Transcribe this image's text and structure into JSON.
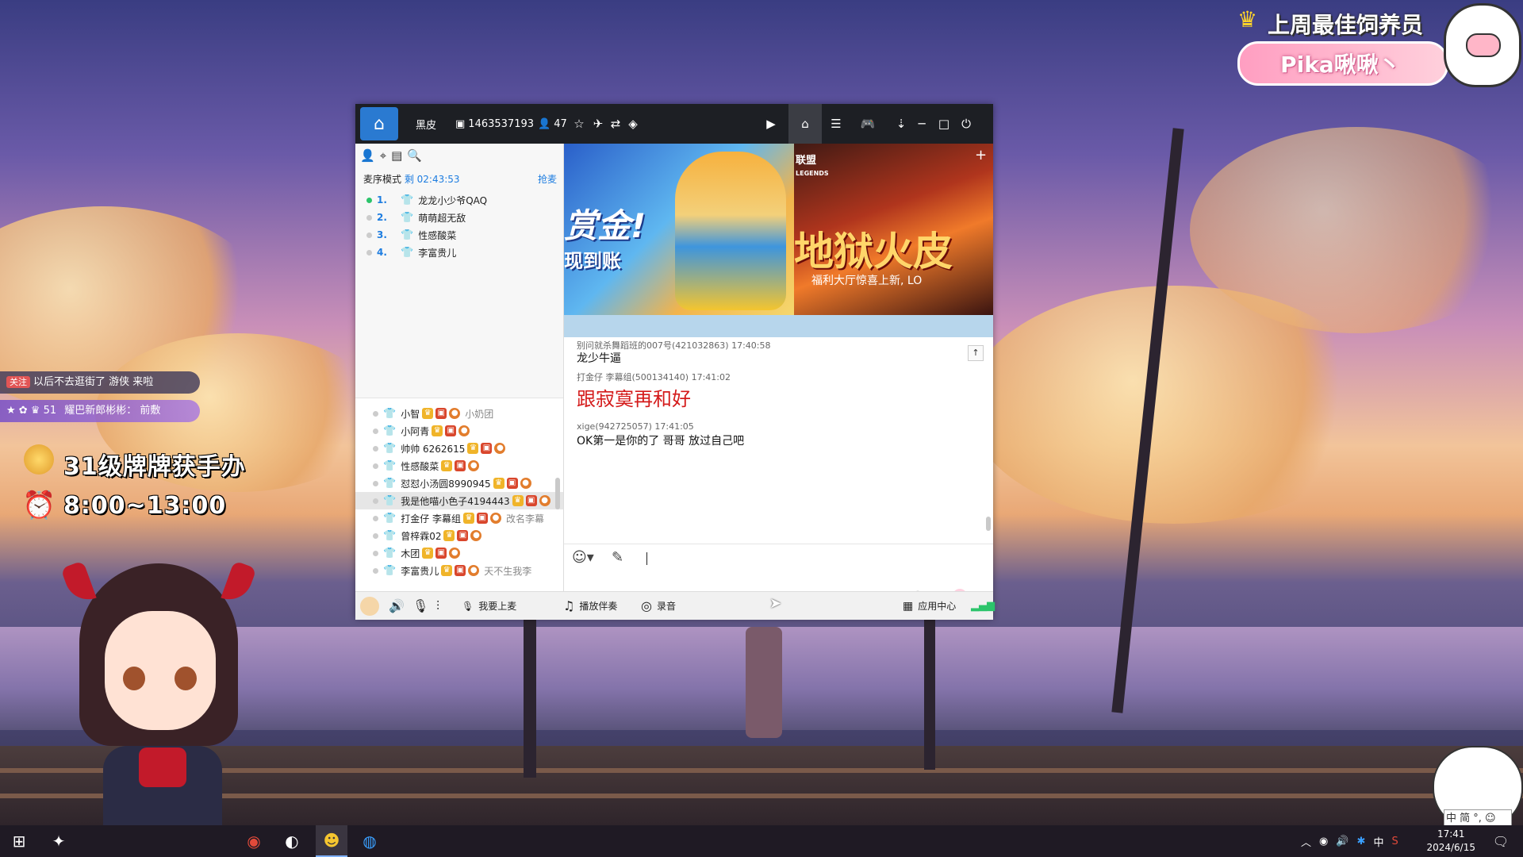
{
  "overlay": {
    "best_feeder_title": "上周最佳饲养员",
    "best_feeder_name": "Pika啾啾丶",
    "ticker1_tag": "关注",
    "ticker1_text": "以后不去逛街了 游侠 来啦",
    "ticker2_level": "51",
    "ticker2_text": "耀巴新郎彬彬： 前敷",
    "level_text": "31级牌牌获手办",
    "schedule_text": "8:00~13:00",
    "ime_text": "中 简 °, ☺"
  },
  "window": {
    "channel_name": "黑皮",
    "room_id": "1463537193",
    "online_count": "47",
    "left": {
      "mic_mode_label": "麦序模式",
      "mic_mode_time": "剩 02:43:53",
      "grab_mic": "抢麦",
      "queue": [
        {
          "num": "1.",
          "name": "龙龙小少爷QAQ",
          "active": true
        },
        {
          "num": "2.",
          "name": "萌萌超无敌",
          "active": false
        },
        {
          "num": "3.",
          "name": "性感酸菜",
          "active": false
        },
        {
          "num": "4.",
          "name": "李富贵儿",
          "active": false
        }
      ],
      "members": [
        {
          "name": "小智",
          "extra": "小奶团"
        },
        {
          "name": "小阿青",
          "extra": ""
        },
        {
          "name": "帅帅 6262615",
          "extra": ""
        },
        {
          "name": "性感酸菜",
          "extra": ""
        },
        {
          "name": "怼怼小汤圆8990945",
          "extra": ""
        },
        {
          "name": "我是他喵小色子4194443",
          "extra": ""
        },
        {
          "name": "打金仔 李幕组",
          "extra": "改名李幕"
        },
        {
          "name": "曾梓霖02",
          "extra": ""
        },
        {
          "name": "木团",
          "extra": ""
        },
        {
          "name": "李富贵儿",
          "extra": "天不生我李"
        }
      ]
    },
    "banner": {
      "text_left_1": "赏金!",
      "text_left_2": "现到账",
      "text_right_brand": "联盟",
      "text_right_brand_sub": "LEGENDS",
      "text_right_main": "地狱火皮",
      "text_right_sub": "福利大厅惊喜上新, LO"
    },
    "chat": [
      {
        "name": "别问就杀舞蹈班的007号(421032863)",
        "time": "17:40:58",
        "text": "龙少牛逼",
        "big": false
      },
      {
        "name": "打金仔 李幕组(500134140)",
        "time": "17:41:02",
        "text": "跟寂寞再和好",
        "big": true
      },
      {
        "name": "xige(942725057)",
        "time": "17:41:05",
        "text": "OK第一是你的了  哥哥   放过自己吧",
        "big": false
      }
    ],
    "bottom": {
      "go_mic": "我要上麦",
      "play_accompaniment": "播放伴奏",
      "record": "录音",
      "app_center": "应用中心"
    }
  },
  "taskbar": {
    "time": "17:41",
    "date": "2024/6/15",
    "lang": "中"
  }
}
